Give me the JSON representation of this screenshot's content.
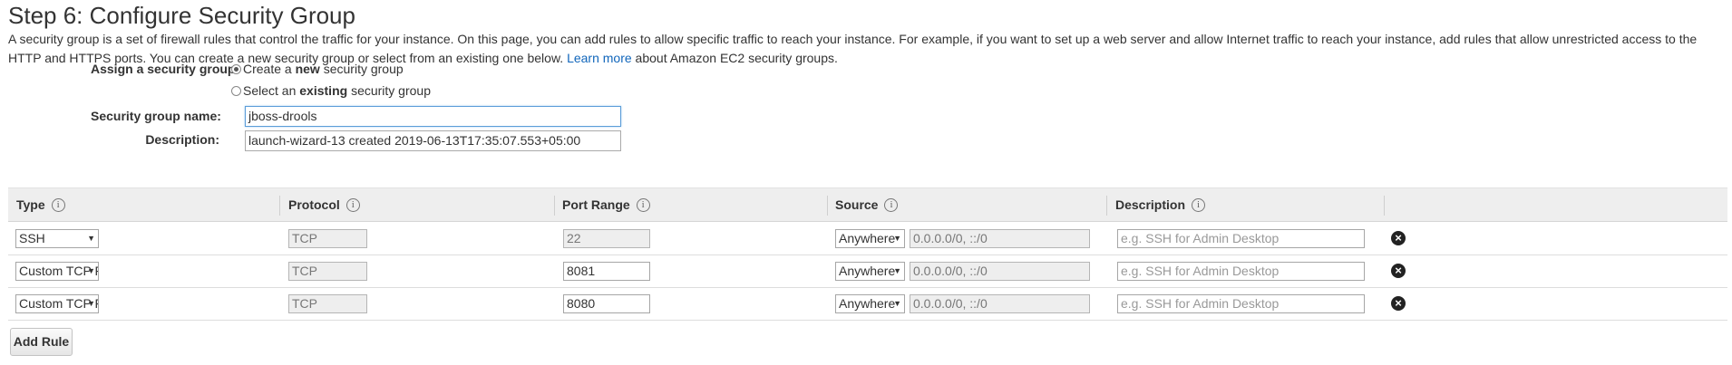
{
  "page": {
    "title": "Step 6: Configure Security Group",
    "intro_part1": "A security group is a set of firewall rules that control the traffic for your instance. On this page, you can add rules to allow specific traffic to reach your instance. For example, if you want to set up a web server and allow Internet traffic to reach your instance, add rules that allow unrestricted access to the HTTP and HTTPS ports. You can create a new security group or select from an existing one below.",
    "learn_more": "Learn more",
    "intro_part2": "about Amazon EC2 security groups."
  },
  "assign": {
    "label": "Assign a security group:",
    "option_new_pre": "Create a",
    "option_new_bold": "new",
    "option_new_post": "security group",
    "option_existing_pre": "Select an",
    "option_existing_bold": "existing",
    "option_existing_post": "security group",
    "selected": "new"
  },
  "group_name": {
    "label": "Security group name:",
    "value": "jboss-drools"
  },
  "description": {
    "label": "Description:",
    "value": "launch-wizard-13 created 2019-06-13T17:35:07.553+05:00"
  },
  "table": {
    "headers": {
      "type": "Type",
      "protocol": "Protocol",
      "port_range": "Port Range",
      "source": "Source",
      "description": "Description"
    },
    "info_glyph": "i",
    "rows": [
      {
        "type": "SSH",
        "protocol": "TCP",
        "port": "22",
        "source": "Anywhere",
        "cidr": "0.0.0.0/0, ::/0",
        "desc_placeholder": "e.g. SSH for Admin Desktop"
      },
      {
        "type": "Custom TCP F",
        "protocol": "TCP",
        "port": "8081",
        "source": "Anywhere",
        "cidr": "0.0.0.0/0, ::/0",
        "desc_placeholder": "e.g. SSH for Admin Desktop"
      },
      {
        "type": "Custom TCP F",
        "protocol": "TCP",
        "port": "8080",
        "source": "Anywhere",
        "cidr": "0.0.0.0/0, ::/0",
        "desc_placeholder": "e.g. SSH for Admin Desktop"
      }
    ]
  },
  "glyphs": {
    "dropdown_arrow": "▼",
    "remove": "×"
  },
  "add_rule_label": "Add Rule",
  "colors": {
    "link": "#1166bb",
    "header_bg": "#eeeeee",
    "disabled_bg": "#eeeeee"
  }
}
